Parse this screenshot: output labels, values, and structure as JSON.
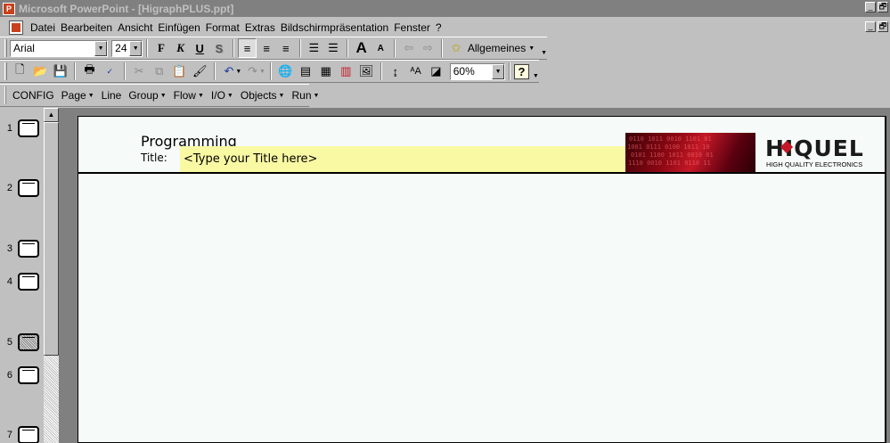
{
  "window": {
    "title": "Microsoft PowerPoint - [HigraphPLUS.ppt]",
    "controls": [
      "_",
      "🗗"
    ]
  },
  "menubar": {
    "items": [
      "Datei",
      "Bearbeiten",
      "Ansicht",
      "Einfügen",
      "Format",
      "Extras",
      "Bildschirmpräsentation",
      "Fenster",
      "?"
    ]
  },
  "format_toolbar": {
    "font": "Arial",
    "size": "24",
    "bold": "F",
    "italic": "K",
    "underline": "U",
    "shadow": "S",
    "font_grow": "A",
    "font_shrink": "A",
    "style_button": "Allgemeines"
  },
  "standard_toolbar": {
    "zoom": "60%",
    "help": "?"
  },
  "custom_toolbar": {
    "items": [
      "CONFIG",
      "Page",
      "Line",
      "Group",
      "Flow",
      "I/O",
      "Objects",
      "Run"
    ]
  },
  "outline": {
    "slides": [
      {
        "num": "1"
      },
      {
        "num": "2"
      },
      {
        "num": "3"
      },
      {
        "num": "4"
      },
      {
        "num": "5",
        "selected": true
      },
      {
        "num": "6"
      },
      {
        "num": "7"
      }
    ]
  },
  "slide": {
    "heading": "Programming",
    "title_label": "Title:",
    "title_placeholder": "<Type your Title here>",
    "logo_word": "HIQUEL",
    "logo_tagline": "HIGH QUALITY ELECTRONICS"
  },
  "colors": {
    "title_bar": "#808080",
    "face": "#c0c0c0",
    "workspace": "#808080",
    "slide_bg": "#f6faf8",
    "title_field": "#f9f9a4",
    "brand_red": "#c41826"
  }
}
